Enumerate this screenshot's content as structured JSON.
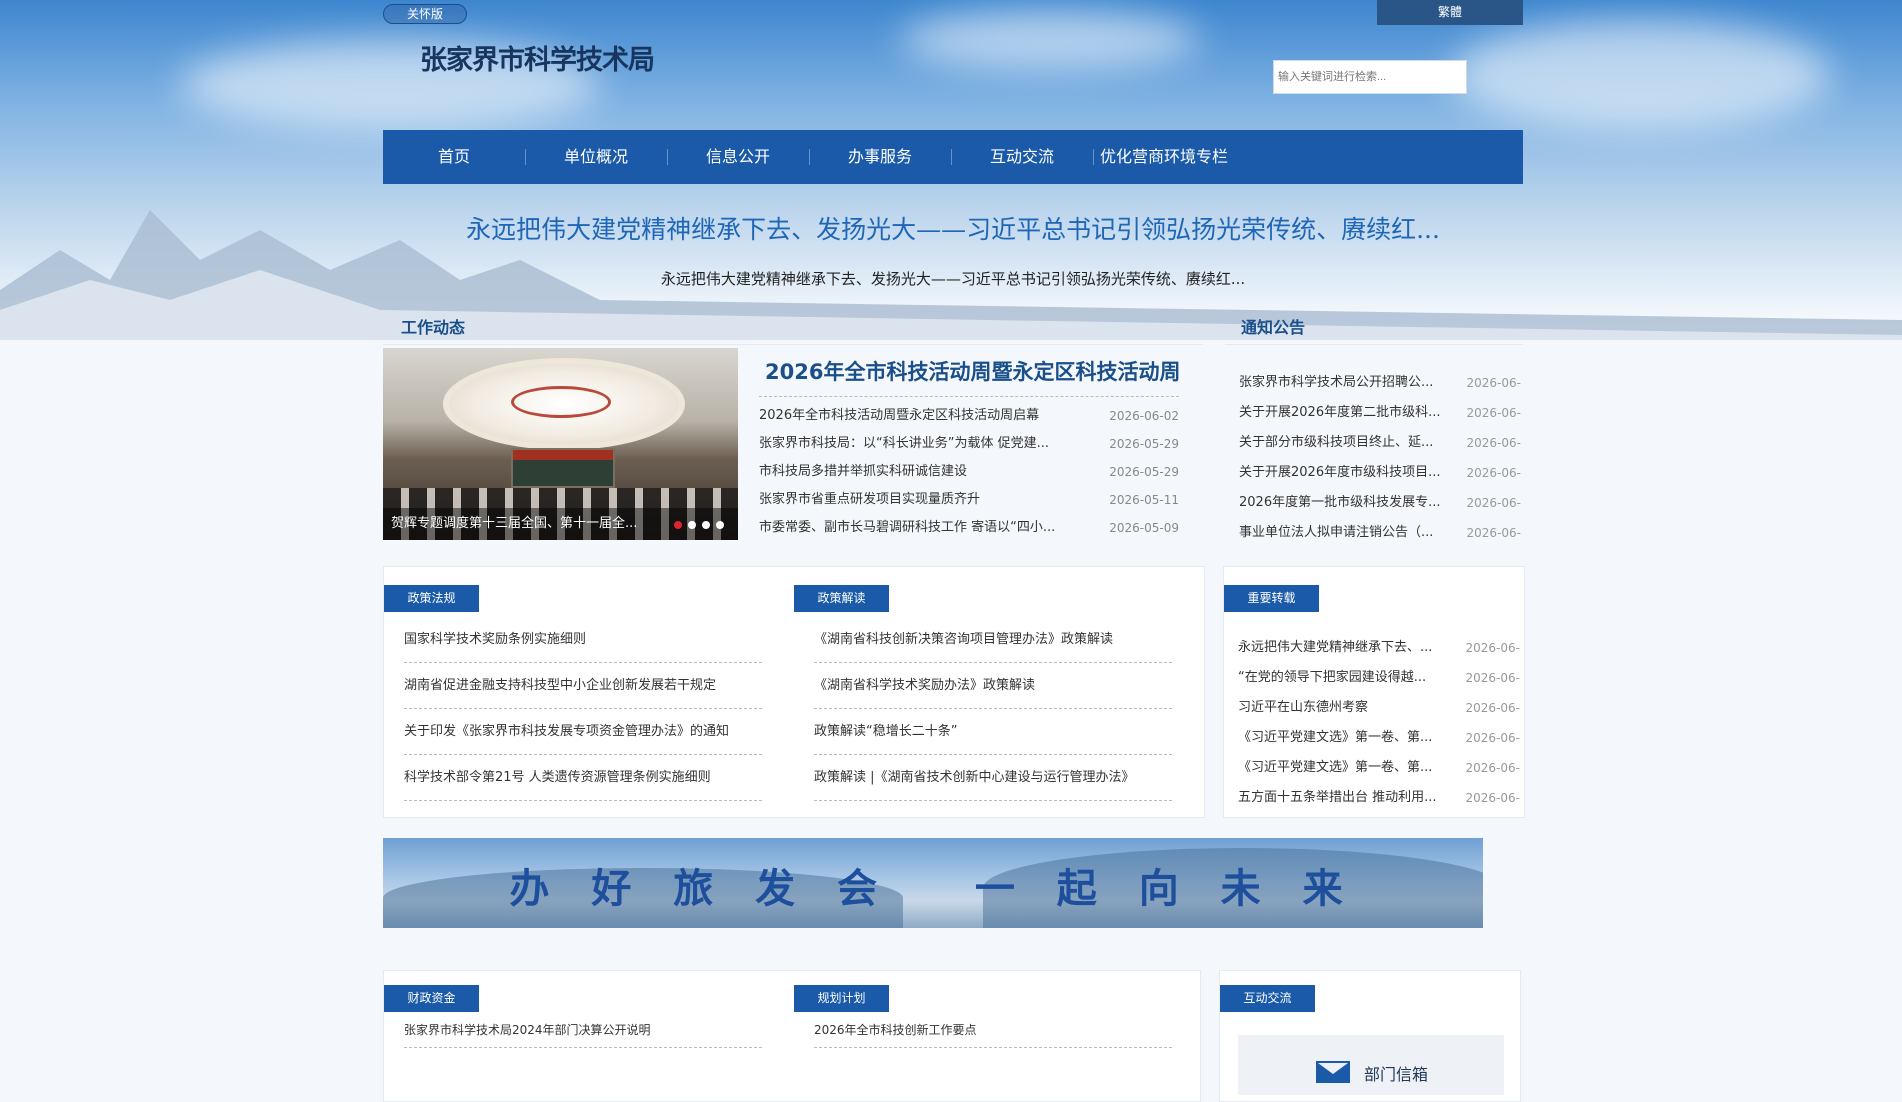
{
  "header": {
    "care_label": "关怀版",
    "trad_label": "繁體",
    "title": "张家界市科学技术局",
    "search_placeholder": "输入关键词进行检索..."
  },
  "nav": [
    "首页",
    "单位概况",
    "信息公开",
    "办事服务",
    "互动交流",
    "优化营商环境专栏"
  ],
  "headline": "永远把伟大建党精神继承下去、发扬光大——习近平总书记引领弘扬光荣传统、赓续红...",
  "subheadline": "永远把伟大建党精神继承下去、发扬光大——习近平总书记引领弘扬光荣传统、赓续红...",
  "work": {
    "title": "工作动态",
    "slide_caption": "贺辉专题调度第十三届全国、第十一届全...",
    "feature_title": "2026年全市科技活动周暨永定区科技活动周",
    "items": [
      {
        "title": "2026年全市科技活动周暨永定区科技活动周启幕",
        "date": "2026-06-02"
      },
      {
        "title": "张家界市科技局：以“科长讲业务”为载体 促党建...",
        "date": "2026-05-29"
      },
      {
        "title": "市科技局多措并举抓实科研诚信建设",
        "date": "2026-05-29"
      },
      {
        "title": "张家界市省重点研发项目实现量质齐升",
        "date": "2026-05-11"
      },
      {
        "title": "市委常委、副市长马碧调研科技工作 寄语以“四小...",
        "date": "2026-05-09"
      }
    ]
  },
  "notice": {
    "title": "通知公告",
    "items": [
      {
        "title": "张家界市科学技术局公开招聘公...",
        "date": "2026-06-"
      },
      {
        "title": "关于开展2026年度第二批市级科...",
        "date": "2026-06-"
      },
      {
        "title": "关于部分市级科技项目终止、延...",
        "date": "2026-06-"
      },
      {
        "title": "关于开展2026年度市级科技项目...",
        "date": "2026-06-"
      },
      {
        "title": "2026年度第一批市级科技发展专...",
        "date": "2026-06-"
      },
      {
        "title": "事业单位法人拟申请注销公告（...",
        "date": "2026-06-"
      }
    ]
  },
  "policy": {
    "tab": "政策法规",
    "items": [
      "国家科学技术奖励条例实施细则",
      "湖南省促进金融支持科技型中小企业创新发展若干规定",
      "关于印发《张家界市科技发展专项资金管理办法》的通知",
      "科学技术部令第21号 人类遗传资源管理条例实施细则"
    ]
  },
  "interpret": {
    "tab": "政策解读",
    "items": [
      "《湖南省科技创新决策咨询项目管理办法》政策解读",
      "《湖南省科学技术奖励办法》政策解读",
      "政策解读“稳增长二十条”",
      "政策解读 |《湖南省技术创新中心建设与运行管理办法》"
    ]
  },
  "important": {
    "tab": "重要转载",
    "items": [
      {
        "title": "永远把伟大建党精神继承下去、...",
        "date": "2026-06-"
      },
      {
        "title": "“在党的领导下把家园建设得越...",
        "date": "2026-06-"
      },
      {
        "title": "习近平在山东德州考察",
        "date": "2026-06-"
      },
      {
        "title": "《习近平党建文选》第一卷、第...",
        "date": "2026-06-"
      },
      {
        "title": "《习近平党建文选》第一卷、第...",
        "date": "2026-06-"
      },
      {
        "title": "五方面十五条举措出台 推动利用...",
        "date": "2026-06-"
      }
    ]
  },
  "banner": {
    "slogan": "办 好 旅 发 会   一 起 向 未 来"
  },
  "finance": {
    "tab": "财政资金",
    "items": [
      "张家界市科学技术局2024年部门决算公开说明"
    ]
  },
  "planning": {
    "tab": "规划计划",
    "items": [
      "2026年全市科技创新工作要点"
    ]
  },
  "interaction": {
    "tab": "互动交流",
    "mail_label": "部门信箱"
  },
  "colors": {
    "nav_bg": "#1a5aa8",
    "title_blue": "#1a4f8a",
    "headline_blue": "#1f67b6",
    "active_dot": "#e0242d"
  }
}
